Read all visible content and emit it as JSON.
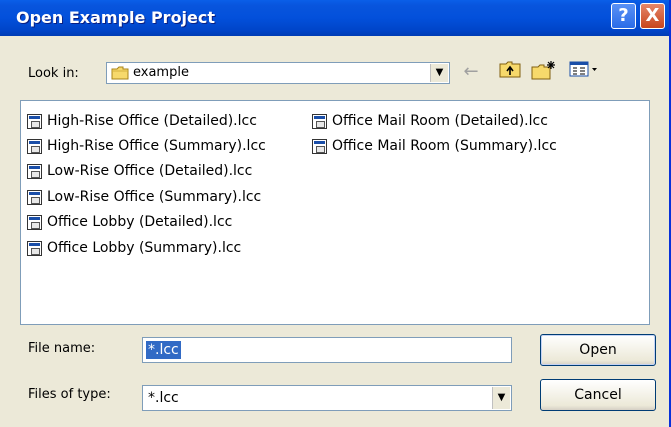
{
  "window": {
    "title": "Open Example Project"
  },
  "titlebar": {
    "help_glyph": "?",
    "close_glyph": "X"
  },
  "lookin": {
    "label": "Look in:",
    "value": "example",
    "folder_icon": "folder-icon",
    "arrow_glyph": "▼"
  },
  "nav": {
    "back_icon": "back-arrow-icon",
    "up_icon": "up-one-level-icon",
    "new_folder_icon": "new-folder-icon",
    "views_icon": "views-menu-icon",
    "back_glyph": "←"
  },
  "files": [
    "High-Rise Office (Detailed).lcc",
    "High-Rise Office (Summary).lcc",
    "Low-Rise Office (Detailed).lcc",
    "Low-Rise Office (Summary).lcc",
    "Office Lobby (Detailed).lcc",
    "Office Lobby (Summary).lcc",
    "Office Mail Room (Detailed).lcc",
    "Office Mail Room (Summary).lcc"
  ],
  "filename": {
    "label": "File name:",
    "value": "*.lcc"
  },
  "filetype": {
    "label": "Files of type:",
    "value": "*.lcc",
    "arrow_glyph": "▼"
  },
  "buttons": {
    "open": "Open",
    "cancel": "Cancel"
  },
  "colors": {
    "titlebar": "#0350db",
    "selection": "#316ac5",
    "face": "#ece9d8",
    "close": "#c8451c"
  }
}
